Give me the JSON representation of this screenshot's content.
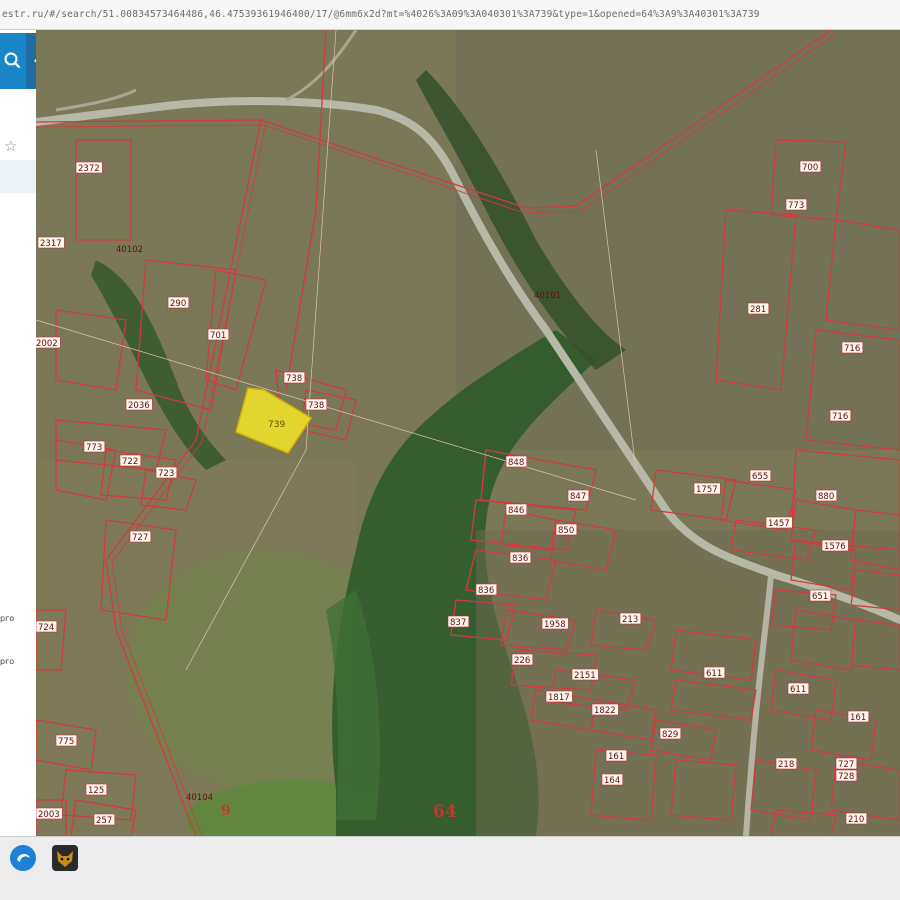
{
  "browser": {
    "url": "estr.ru/#/search/51.00834573464486,46.47539361946400/17/@6mm6x2d?mt=%4026%3A09%3A040301%3A739&type=1&opened=64%3A9%3A40301%3A739"
  },
  "sidebar": {
    "search_icon": "magnifier-icon",
    "collapse_glyph": "‹",
    "favorite_glyph": "☆",
    "items": [
      {
        "label": "рго"
      },
      {
        "label": "рго"
      }
    ]
  },
  "map": {
    "selected_plot": "739",
    "quarter_labels": [
      "40102",
      "40104",
      "40101"
    ],
    "zone_labels": [
      "9",
      "64"
    ],
    "plot_labels": [
      {
        "id": "p1",
        "text": "2372"
      },
      {
        "id": "p2",
        "text": "2317"
      },
      {
        "id": "p3",
        "text": "2002"
      },
      {
        "id": "p4",
        "text": "290"
      },
      {
        "id": "p5",
        "text": "701"
      },
      {
        "id": "p6",
        "text": "738"
      },
      {
        "id": "p7",
        "text": "738"
      },
      {
        "id": "p8",
        "text": "2036"
      },
      {
        "id": "p9",
        "text": "773"
      },
      {
        "id": "p10",
        "text": "722"
      },
      {
        "id": "p11",
        "text": "723"
      },
      {
        "id": "p12",
        "text": "727"
      },
      {
        "id": "p13",
        "text": "775"
      },
      {
        "id": "p14",
        "text": "125"
      },
      {
        "id": "p15",
        "text": "257"
      },
      {
        "id": "p16",
        "text": "2003"
      },
      {
        "id": "p17",
        "text": "724"
      },
      {
        "id": "p18",
        "text": "700"
      },
      {
        "id": "p19",
        "text": "773"
      },
      {
        "id": "p20",
        "text": "281"
      },
      {
        "id": "p21",
        "text": "716"
      },
      {
        "id": "p22",
        "text": "716"
      },
      {
        "id": "p23",
        "text": "848"
      },
      {
        "id": "p24",
        "text": "847"
      },
      {
        "id": "p25",
        "text": "846"
      },
      {
        "id": "p26",
        "text": "850"
      },
      {
        "id": "p27",
        "text": "836"
      },
      {
        "id": "p28",
        "text": "836"
      },
      {
        "id": "p29",
        "text": "837"
      },
      {
        "id": "p30",
        "text": "1958"
      },
      {
        "id": "p31",
        "text": "213"
      },
      {
        "id": "p32",
        "text": "226"
      },
      {
        "id": "p33",
        "text": "2151"
      },
      {
        "id": "p34",
        "text": "1817"
      },
      {
        "id": "p35",
        "text": "1822"
      },
      {
        "id": "p36",
        "text": "829"
      },
      {
        "id": "p37",
        "text": "611"
      },
      {
        "id": "p38",
        "text": "611"
      },
      {
        "id": "p39",
        "text": "161"
      },
      {
        "id": "p40",
        "text": "164"
      },
      {
        "id": "p41",
        "text": "1576"
      },
      {
        "id": "p42",
        "text": "655"
      },
      {
        "id": "p43",
        "text": "880"
      },
      {
        "id": "p44",
        "text": "1757"
      },
      {
        "id": "p45",
        "text": "1457"
      },
      {
        "id": "p46",
        "text": "651"
      },
      {
        "id": "p47",
        "text": "218"
      },
      {
        "id": "p48",
        "text": "727"
      },
      {
        "id": "p49",
        "text": "728"
      },
      {
        "id": "p50",
        "text": "161"
      },
      {
        "id": "p51",
        "text": "210"
      }
    ]
  }
}
